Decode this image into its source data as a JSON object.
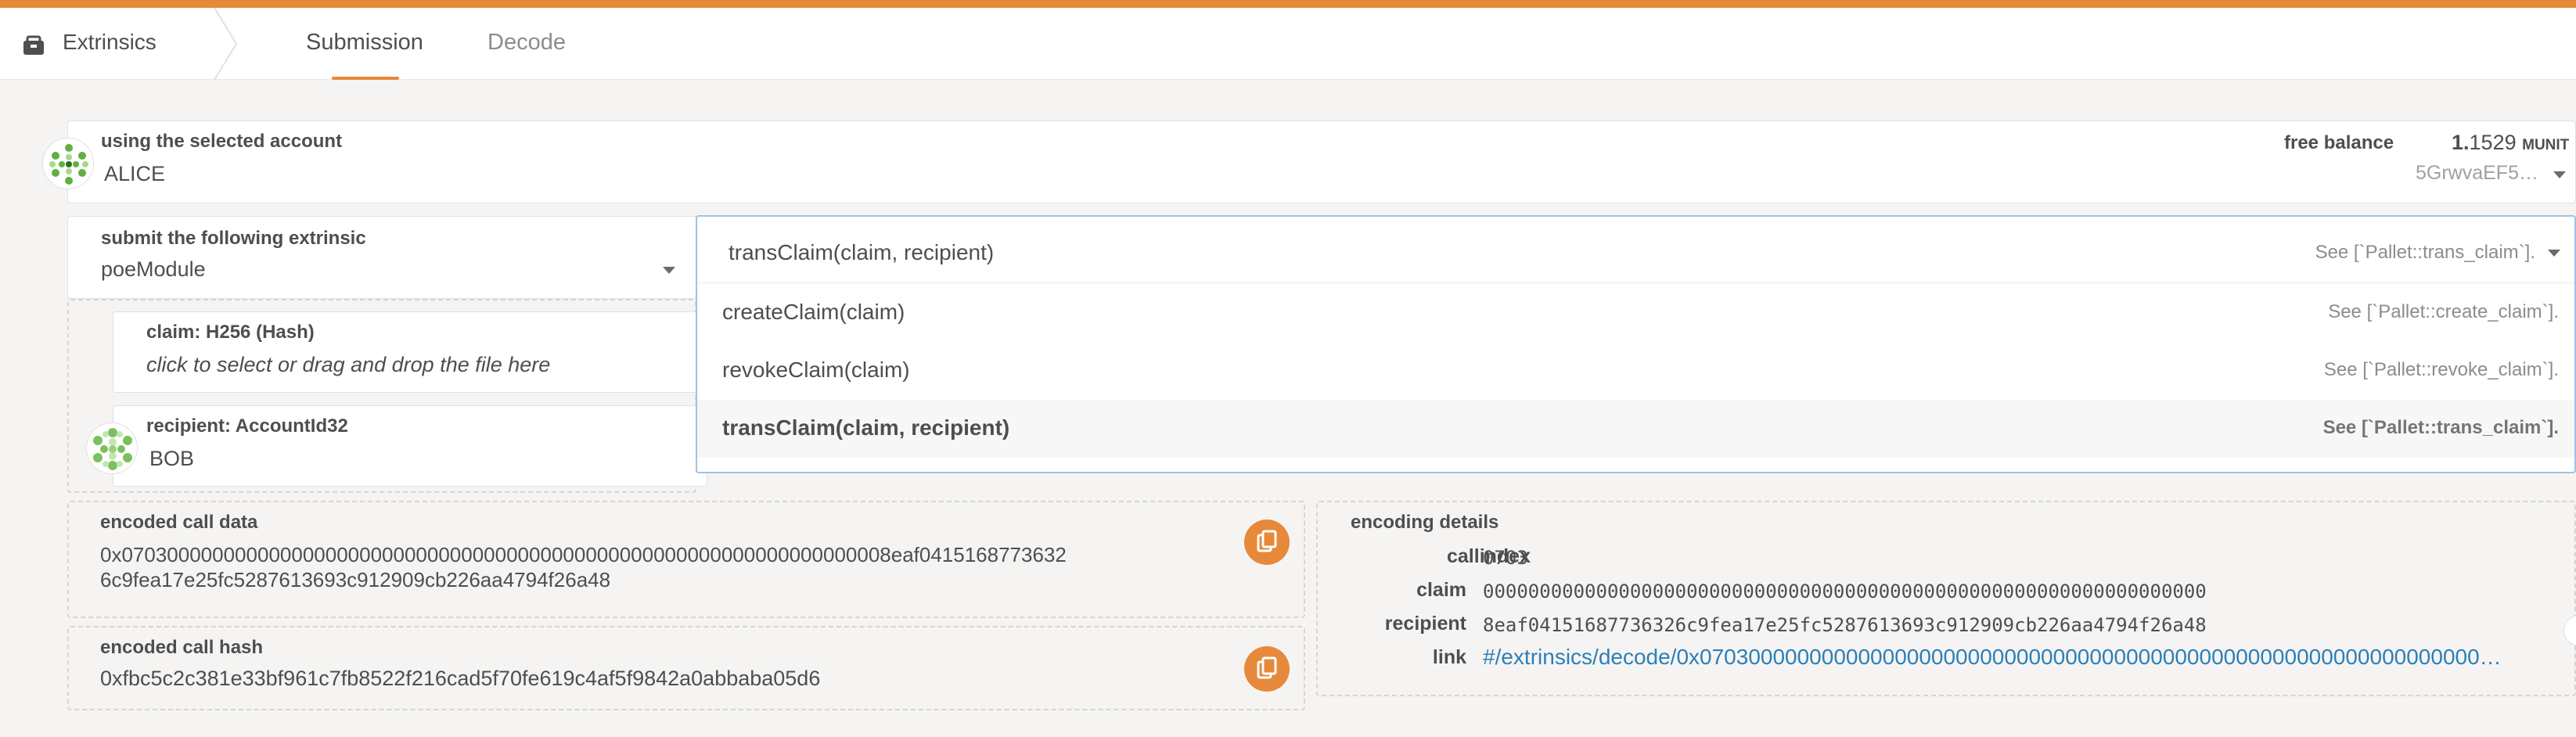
{
  "nav": {
    "section": "Extrinsics",
    "tabs": [
      {
        "label": "Submission",
        "active": true
      },
      {
        "label": "Decode",
        "active": false
      }
    ],
    "accent": "#e6893a"
  },
  "account": {
    "label": "using the selected account",
    "name": "ALICE",
    "balance_label": "free balance",
    "balance_int": "1.",
    "balance_dec": "1529",
    "balance_unit": "MUNIT",
    "address": "5GrwvaEF5…"
  },
  "extrinsic": {
    "label": "submit the following extrinsic",
    "module": "poeModule",
    "selected": {
      "name": "transClaim(claim, recipient)",
      "doc": "See [`Pallet::trans_claim`]."
    },
    "options": [
      {
        "name": "createClaim(claim)",
        "doc": "See [`Pallet::create_claim`]."
      },
      {
        "name": "revokeClaim(claim)",
        "doc": "See [`Pallet::revoke_claim`]."
      },
      {
        "name": "transClaim(claim, recipient)",
        "doc": "See [`Pallet::trans_claim`]."
      }
    ]
  },
  "params": {
    "claim_label": "claim: H256 (Hash)",
    "claim_placeholder": "click to select or drag and drop the file here",
    "recipient_label": "recipient: AccountId32",
    "recipient_value": "BOB"
  },
  "encoded": {
    "call_data_label": "encoded call data",
    "call_data_line1": "0x07030000000000000000000000000000000000000000000000000000000000000008eaf0415168773632",
    "call_data_line2": "6c9fea17e25fc5287613693c912909cb226aa4794f26a48",
    "call_hash_label": "encoded call hash",
    "call_hash": "0xfbc5c2c381e33bf961c7fb8522f216cad5f70fe619c4af5f9842a0abbaba05d6"
  },
  "details": {
    "title": "encoding details",
    "rows": [
      {
        "key": "callindex",
        "value": "0703"
      },
      {
        "key": "claim",
        "value": "0000000000000000000000000000000000000000000000000000000000000000"
      },
      {
        "key": "recipient",
        "value": "8eaf04151687736326c9fea17e25fc5287613693c912909cb226aa4794f26a48"
      },
      {
        "key": "link",
        "value": "#/extrinsics/decode/0x0703000000000000000000000000000000000000000000000000000000000000…"
      }
    ]
  }
}
